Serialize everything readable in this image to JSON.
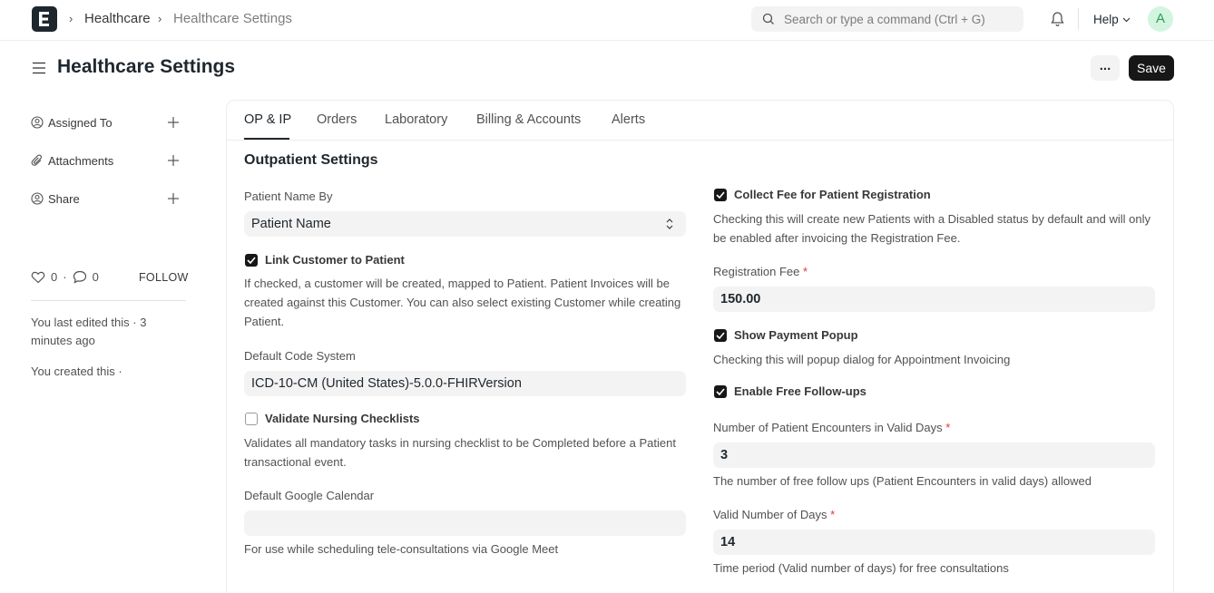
{
  "navbar": {
    "breadcrumbs": [
      "Healthcare",
      "Healthcare Settings"
    ],
    "search_placeholder": "Search or type a command (Ctrl + G)",
    "help_label": "Help",
    "avatar_initial": "A"
  },
  "page": {
    "title": "Healthcare Settings",
    "more_label": "...",
    "save_label": "Save"
  },
  "sidebar": {
    "items": [
      {
        "label": "Assigned To",
        "icon": "assign-user-icon"
      },
      {
        "label": "Attachments",
        "icon": "paperclip-icon"
      },
      {
        "label": "Share",
        "icon": "share-user-icon"
      }
    ],
    "likes": "0",
    "comments": "0",
    "dot": "·",
    "follow_label": "FOLLOW",
    "last_edited": "You last edited this · 3 minutes ago",
    "created": "You created this ·"
  },
  "tabs": [
    {
      "label": "OP & IP",
      "active": true
    },
    {
      "label": "Orders",
      "active": false
    },
    {
      "label": "Laboratory",
      "active": false
    },
    {
      "label": "Billing & Accounts",
      "active": false
    },
    {
      "label": "Alerts",
      "active": false
    }
  ],
  "section": {
    "title": "Outpatient Settings"
  },
  "left": {
    "patient_name_by": {
      "label": "Patient Name By",
      "value": "Patient Name"
    },
    "link_customer": {
      "label": "Link Customer to Patient",
      "checked": true,
      "description": "If checked, a customer will be created, mapped to Patient. Patient Invoices will be created against this Customer. You can also select existing Customer while creating Patient."
    },
    "default_code_system": {
      "label": "Default Code System",
      "value": "ICD-10-CM (United States)-5.0.0-FHIRVersion"
    },
    "validate_nursing": {
      "label": "Validate Nursing Checklists",
      "checked": false,
      "description": "Validates all mandatory tasks in nursing checklist to be Completed before a Patient transactional event."
    },
    "google_calendar": {
      "label": "Default Google Calendar",
      "value": "",
      "description": "For use while scheduling tele-consultations via Google Meet"
    }
  },
  "right": {
    "collect_fee": {
      "label": "Collect Fee for Patient Registration",
      "checked": true,
      "description": "Checking this will create new Patients with a Disabled status by default and will only be enabled after invoicing the Registration Fee."
    },
    "registration_fee": {
      "label": "Registration Fee",
      "required_mark": "*",
      "value": "150.00"
    },
    "payment_popup": {
      "label": "Show Payment Popup",
      "checked": true,
      "description": "Checking this will popup dialog for Appointment Invoicing"
    },
    "free_followups": {
      "label": "Enable Free Follow-ups",
      "checked": true
    },
    "encounters": {
      "label": "Number of Patient Encounters in Valid Days",
      "required_mark": "*",
      "value": "3",
      "description": "The number of free follow ups (Patient Encounters in valid days) allowed"
    },
    "valid_days": {
      "label": "Valid Number of Days",
      "required_mark": "*",
      "value": "14",
      "description": "Time period (Valid number of days) for free consultations"
    }
  },
  "colors": {
    "primary_button": "#171717",
    "avatar_bg": "#d3f5df",
    "avatar_fg": "#2f9d58",
    "required": "#e03636"
  }
}
